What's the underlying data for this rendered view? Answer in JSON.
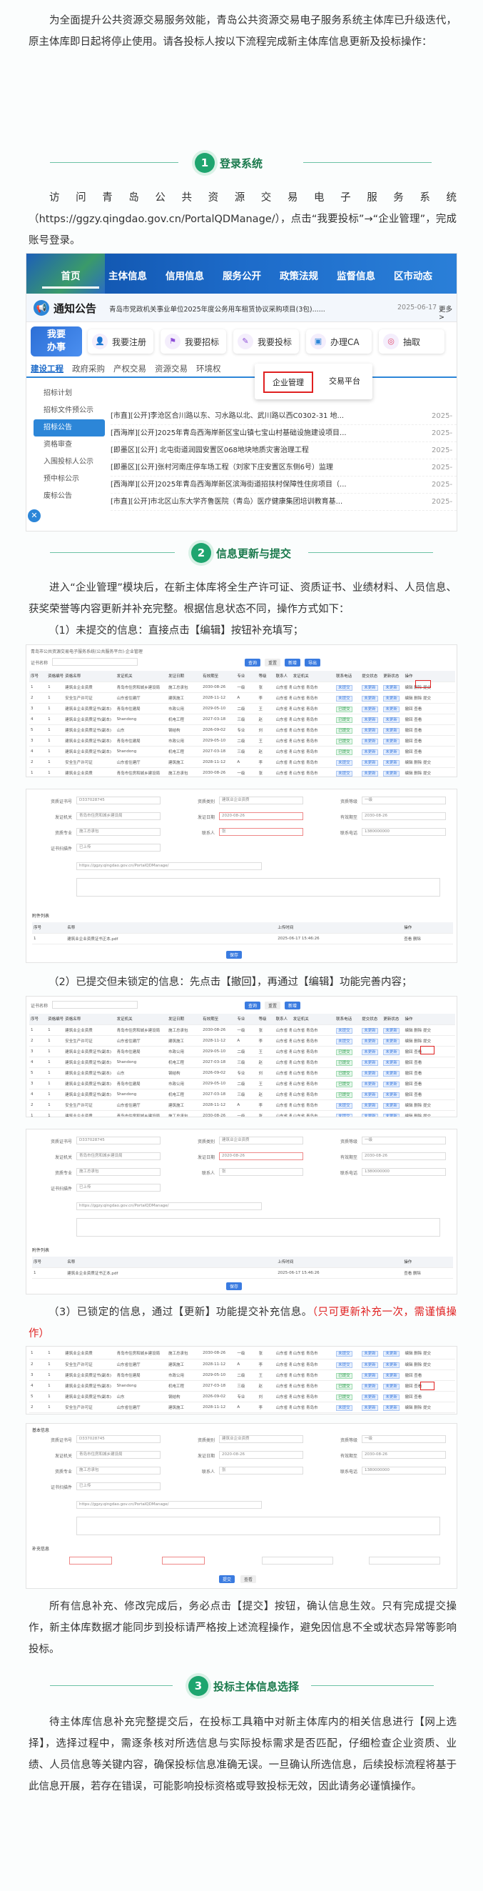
{
  "intro": "为全面提升公共资源交易服务效能，青岛公共资源交易电子服务系统主体库已升级迭代，原主体库即日起将停止使用。请各投标人按以下流程完成新主体库信息更新及投标操作：",
  "sections": [
    {
      "num": "1",
      "title": "登录系统"
    },
    {
      "num": "2",
      "title": "信息更新与提交"
    },
    {
      "num": "3",
      "title": "投标主体信息选择"
    }
  ],
  "step1_text": "访问青岛公共资源交易电子服务系统（https://ggzy.qingdao.gov.cn/PortalQDManage/），点击“我要投标”→“企业管理”，完成账号登录。",
  "portal": {
    "nav": [
      "首页",
      "主体信息",
      "信用信息",
      "服务公开",
      "政策法规",
      "监督信息",
      "区市动态"
    ],
    "notice_label": "通知公告",
    "notice_text": "青岛市党政机关事业单位2025年度公务用车租赁协议采购项目(3包)......",
    "notice_date": "2025-06-17",
    "notice_more": "更多>",
    "woyao": "我要\n办事",
    "services": [
      {
        "label": "我要注册",
        "icon": "user-add-icon",
        "color": "#e0486a"
      },
      {
        "label": "我要招标",
        "icon": "flag-icon",
        "color": "#8e4fd8"
      },
      {
        "label": "我要投标",
        "icon": "bid-icon",
        "color": "#8e4fd8"
      },
      {
        "label": "办理CA",
        "icon": "ca-icon",
        "color": "#2c86d8"
      },
      {
        "label": "抽取",
        "icon": "draw-icon",
        "color": "#e0486a"
      }
    ],
    "tabs": [
      "建设工程",
      "政府采购",
      "产权交易",
      "资源交易",
      "环境权"
    ],
    "dropdown": [
      "企业管理",
      "交易平台"
    ],
    "side": [
      "招标计划",
      "招标文件预公示",
      "招标公告",
      "资格审查",
      "入围投标人公示",
      "预中标公示",
      "废标公告"
    ],
    "rows": [
      {
        "t": "[市直][公开]李沧区合川路以东、习水路以北、武川路以西C0302-31 地...",
        "d": "2025-"
      },
      {
        "t": "[西海岸][公开]2025年青岛西海岸新区宝山镇七宝山村基础设施建设项目...",
        "d": "2025-"
      },
      {
        "t": "[即墨区][公开] 北屯街道润园安置区068地块地质灾害治理工程",
        "d": "2025-"
      },
      {
        "t": "[即墨区][公开]张村河南庄停车场工程（刘家下庄安置区东侧6号）监理",
        "d": "2025-"
      },
      {
        "t": "[西海岸][公开]2025年青岛西海岸新区滨海街道招扶村保障性住房项目（...",
        "d": "2025-"
      },
      {
        "t": "[市直][公开]市北区山东大学齐鲁医院（青岛）医疗健康集团培训教育基...",
        "d": "2025-"
      }
    ]
  },
  "step2_text": "进入“企业管理”模块后，在新主体库将全生产许可证、资质证书、业绩材料、人员信息、获奖荣誉等内容更新并补充完整。根据信息状态不同，操作方式如下：",
  "step2_a": "（1）未提交的信息：直接点击【编辑】按钮补充填写；",
  "step2_b": "（2）已提交但未锁定的信息：先点击【撤回】，再通过【编辑】功能完善内容；",
  "step2_c": "（3）已锁定的信息，通过【更新】功能提交补充信息。",
  "step2_c_red": "（只可更新补充一次，需谨慎操作）",
  "submit_text": "所有信息补充、修改完成后，务必点击【提交】按钮，确认信息生效。只有完成提交操作，新主体库数据才能同步到投标请严格按上述流程操作，避免因信息不全或状态异常等影响投标。",
  "step3_text": "待主体库信息补充完整提交后，在投标工具箱中对新主体库内的相关信息进行【网上选择】，选择过程中，需逐条核对所选信息与实际投标需求是否匹配，仔细检查企业资质、业绩、人员信息等关键内容，确保投标信息准确无误。一旦确认所选信息，后续投标流程将基于此信息开展，若存在错误，可能影响投标资格或导致投标无效，因此请务必谨慎操作。",
  "mini": {
    "title": "青岛市公共资源交易电子服务系统(公共服务平台)-企业管理",
    "search_label": "证书名称",
    "search_btns": [
      "查询",
      "重置",
      "新增",
      "导出"
    ],
    "headers": [
      "序号",
      "资格编号",
      "资格名称",
      "发证机关",
      "发证日期",
      "有效期至",
      "专业",
      "等级",
      "联系人",
      "发证机关",
      "联系电话",
      "提交状态",
      "更新状态",
      "操作"
    ],
    "rows": [
      [
        "1",
        "1",
        "建筑业企业资质",
        "青岛市住房和城乡建设局",
        "施工总承包",
        "2030-08-26",
        "一级",
        "张",
        "山东省 青岛市",
        "未提交",
        "未更新",
        "编辑  删除  提交"
      ],
      [
        "2",
        "1",
        "安全生产许可证",
        "山东省住建厅",
        "建筑施工",
        "2028-11-12",
        "A",
        "李",
        "山东省 青岛市",
        "未提交",
        "未更新",
        "编辑  删除  提交"
      ],
      [
        "3",
        "1",
        "建筑业企业资质证书(副本)",
        "青岛市住建局",
        "市政公用",
        "2029-05-10",
        "二级",
        "王",
        "山东省 青岛市",
        "已提交",
        "未更新",
        "撤回  查看"
      ],
      [
        "4",
        "1",
        "建筑业企业资质证书(副本)",
        "Shandong",
        "机电工程",
        "2027-03-18",
        "三级",
        "赵",
        "山东省 青岛市",
        "已提交",
        "未更新",
        "撤回  查看"
      ],
      [
        "5",
        "1",
        "建筑业企业资质证书(副本)",
        "山东",
        "钢结构",
        "2026-09-02",
        "专业",
        "刘",
        "山东省 青岛市",
        "已提交",
        "未更新",
        "撤回  查看"
      ]
    ],
    "form_labels": [
      "资质证书号",
      "资质类别",
      "资质等级",
      "发证机关",
      "发证日期",
      "有效期至",
      "资质专业",
      "联系人",
      "联系电话",
      "证书扫描件"
    ],
    "form_values": [
      "D337028745",
      "建筑业企业资质",
      "一级",
      "青岛市住房和城乡建设局",
      "2020-08-26",
      "2030-08-26",
      "施工总承包",
      "张",
      "1380000000",
      "已上传"
    ],
    "url": "https://ggzy.qingdao.gov.cn/PortalQDManage/",
    "attach_headers": [
      "序号",
      "名称",
      "上传时间",
      "操作"
    ],
    "attach_row": [
      "1",
      "建筑业企业资质证书正本.pdf",
      "2025-06-17 15:46:26",
      "查看  删除"
    ],
    "save_btn": "保存",
    "submit_btn": "提交",
    "update_btn": "更新",
    "view_btn": "查看",
    "recall_btn": "撤回",
    "edit_btn": "编辑"
  },
  "colors": {
    "accent": "#1ea56f",
    "nav": "#1d6bc9",
    "red": "#e02020",
    "link": "#3a7be0"
  }
}
